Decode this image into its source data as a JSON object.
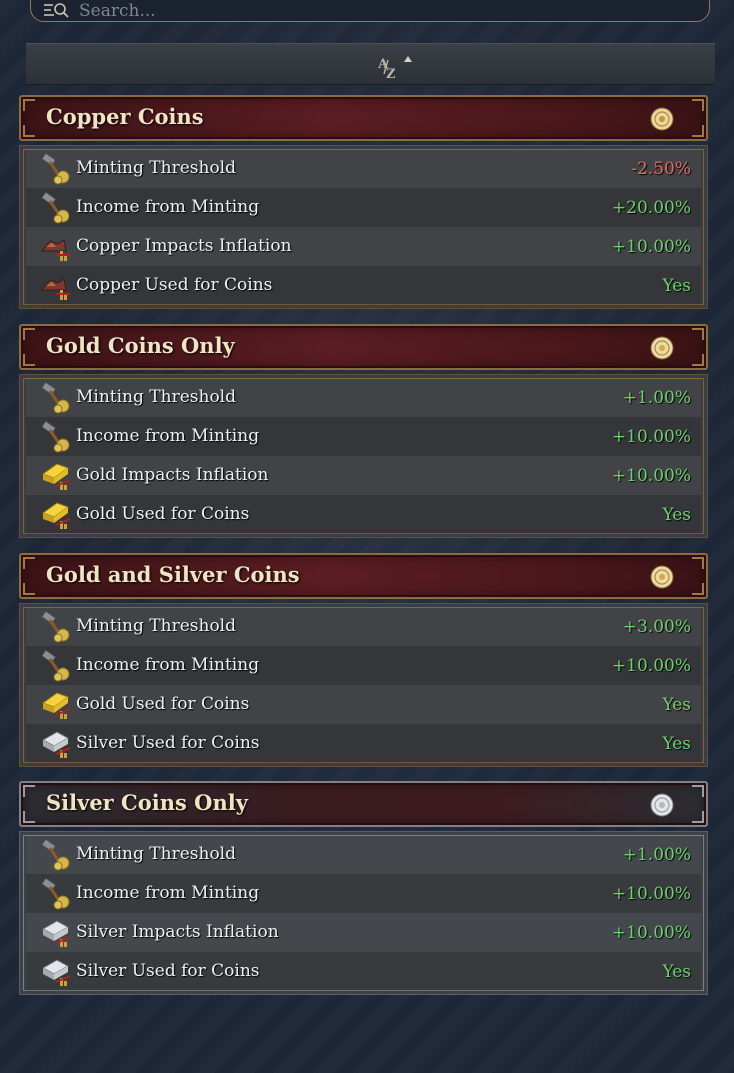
{
  "search": {
    "placeholder": "Search..."
  },
  "sort": {
    "icon": "sort-az-icon"
  },
  "colors": {
    "positive": "#6ecf6e",
    "negative": "#e06a5e",
    "header_text": "#f0e4c4"
  },
  "groups": [
    {
      "title": "Copper Coins",
      "badge_icon": "copper-coin-icon",
      "rows": [
        {
          "icon": "minting-hammer-icon",
          "label": "Minting Threshold",
          "value": "-2.50%"
        },
        {
          "icon": "minting-hammer-icon",
          "label": "Income from Minting",
          "value": "+20.00%"
        },
        {
          "icon": "copper-ore-icon",
          "label": "Copper Impacts Inflation",
          "value": "+10.00%"
        },
        {
          "icon": "copper-ore-icon",
          "label": "Copper Used for Coins",
          "value": "Yes"
        }
      ]
    },
    {
      "title": "Gold Coins Only",
      "badge_icon": "gold-coin-icon",
      "rows": [
        {
          "icon": "minting-hammer-icon",
          "label": "Minting Threshold",
          "value": "+1.00%"
        },
        {
          "icon": "minting-hammer-icon",
          "label": "Income from Minting",
          "value": "+10.00%"
        },
        {
          "icon": "gold-bar-icon",
          "label": "Gold Impacts Inflation",
          "value": "+10.00%"
        },
        {
          "icon": "gold-bar-icon",
          "label": "Gold Used for Coins",
          "value": "Yes"
        }
      ]
    },
    {
      "title": "Gold and Silver Coins",
      "badge_icon": "gold-coin-icon",
      "rows": [
        {
          "icon": "minting-hammer-icon",
          "label": "Minting Threshold",
          "value": "+3.00%"
        },
        {
          "icon": "minting-hammer-icon",
          "label": "Income from Minting",
          "value": "+10.00%"
        },
        {
          "icon": "gold-bar-icon",
          "label": "Gold Used for Coins",
          "value": "Yes"
        },
        {
          "icon": "silver-bar-icon",
          "label": "Silver Used for Coins",
          "value": "Yes"
        }
      ]
    },
    {
      "title": "Silver Coins Only",
      "badge_icon": "silver-coin-icon",
      "rows": [
        {
          "icon": "minting-hammer-icon",
          "label": "Minting Threshold",
          "value": "+1.00%"
        },
        {
          "icon": "minting-hammer-icon",
          "label": "Income from Minting",
          "value": "+10.00%"
        },
        {
          "icon": "silver-bar-icon",
          "label": "Silver Impacts Inflation",
          "value": "+10.00%"
        },
        {
          "icon": "silver-bar-icon",
          "label": "Silver Used for Coins",
          "value": "Yes"
        }
      ]
    }
  ]
}
